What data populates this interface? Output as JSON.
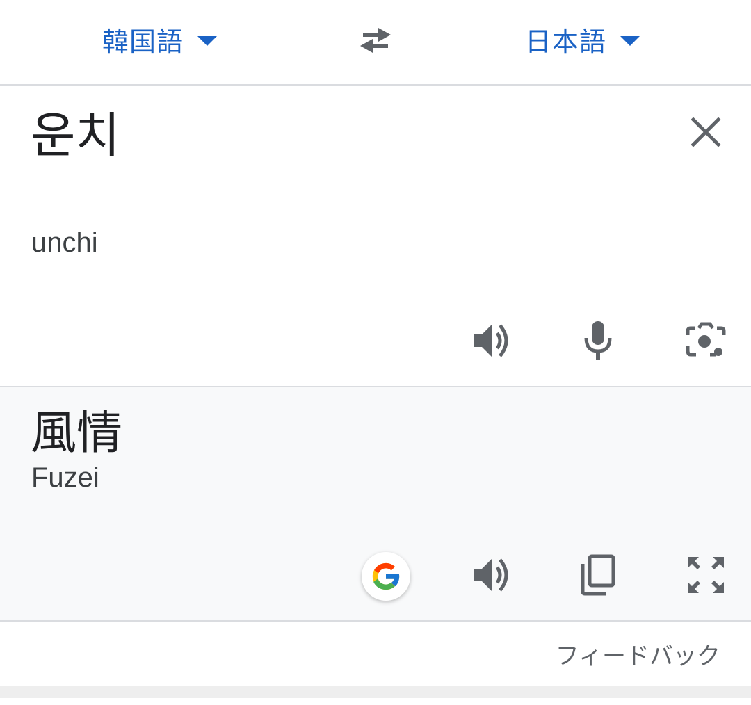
{
  "language_bar": {
    "source_language": "韓国語",
    "target_language": "日本語",
    "swap_icon": "swap-arrows-icon",
    "dropdown_icon": "caret-down-icon"
  },
  "source": {
    "text": "운치",
    "transliteration": "unchi",
    "icons": [
      "clear-icon",
      "speaker-icon",
      "microphone-icon",
      "camera-icon"
    ]
  },
  "result": {
    "text": "風情",
    "transliteration": "Fuzei",
    "icons": [
      "google-logo-icon",
      "speaker-icon",
      "copy-icon",
      "fullscreen-icon"
    ]
  },
  "feedback": {
    "label": "フィードバック"
  },
  "colors": {
    "accent": "#1a62c5",
    "icon": "#5f6368",
    "result_background": "#f8f9fa",
    "divider": "#dadce0"
  }
}
